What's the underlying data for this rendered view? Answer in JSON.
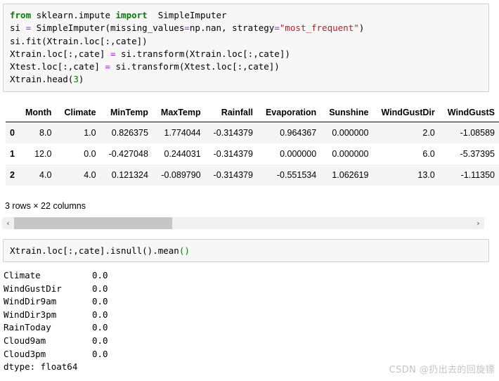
{
  "cell_1": {
    "lines": [
      [
        {
          "t": "from",
          "c": "kw"
        },
        {
          "t": " sklearn.impute ",
          "c": "plain"
        },
        {
          "t": "import",
          "c": "kw"
        },
        {
          "t": "  SimpleImputer",
          "c": "plain"
        }
      ],
      [
        {
          "t": "si ",
          "c": "plain"
        },
        {
          "t": "=",
          "c": "op"
        },
        {
          "t": " SimpleImputer(missing_values",
          "c": "plain"
        },
        {
          "t": "=",
          "c": "op"
        },
        {
          "t": "np.nan, strategy",
          "c": "plain"
        },
        {
          "t": "=",
          "c": "op"
        },
        {
          "t": "\"most_frequent\"",
          "c": "str"
        },
        {
          "t": ")",
          "c": "plain"
        }
      ],
      [
        {
          "t": "si.fit(Xtrain.loc[:,cate])",
          "c": "plain"
        }
      ],
      [
        {
          "t": "Xtrain.loc[:,cate] ",
          "c": "plain"
        },
        {
          "t": "=",
          "c": "op"
        },
        {
          "t": " si.transform(Xtrain.loc[:,cate])",
          "c": "plain"
        }
      ],
      [
        {
          "t": "Xtest.loc[:,cate] ",
          "c": "plain"
        },
        {
          "t": "=",
          "c": "op"
        },
        {
          "t": " si.transform(Xtest.loc[:,cate])",
          "c": "plain"
        }
      ],
      [
        {
          "t": "Xtrain.head(",
          "c": "plain"
        },
        {
          "t": "3",
          "c": "num"
        },
        {
          "t": ")",
          "c": "plain"
        }
      ]
    ]
  },
  "cell_2": {
    "lines": [
      [
        {
          "t": "Xtrain.loc[:,cate].isnull().mean",
          "c": "plain"
        },
        {
          "t": "()",
          "c": "num"
        }
      ]
    ]
  },
  "dataframe": {
    "index_header": "",
    "columns": [
      "Month",
      "Climate",
      "MinTemp",
      "MaxTemp",
      "Rainfall",
      "Evaporation",
      "Sunshine",
      "WindGustDir",
      "WindGustS"
    ],
    "rows": [
      {
        "index": "0",
        "values": [
          "8.0",
          "1.0",
          "0.826375",
          "1.774044",
          "-0.314379",
          "0.964367",
          "0.000000",
          "2.0",
          "-1.08589"
        ]
      },
      {
        "index": "1",
        "values": [
          "12.0",
          "0.0",
          "-0.427048",
          "0.244031",
          "-0.314379",
          "0.000000",
          "0.000000",
          "6.0",
          "-5.37395"
        ]
      },
      {
        "index": "2",
        "values": [
          "4.0",
          "4.0",
          "0.121324",
          "-0.089790",
          "-0.314379",
          "-0.551534",
          "1.062619",
          "13.0",
          "-1.11350"
        ]
      }
    ],
    "shape_caption": "3 rows × 22 columns",
    "scrollbar": {
      "left_arrow": "‹",
      "right_arrow": "›"
    }
  },
  "series_output": {
    "rows": [
      {
        "name": "Climate",
        "value": "0.0"
      },
      {
        "name": "WindGustDir",
        "value": "0.0"
      },
      {
        "name": "WindDir9am",
        "value": "0.0"
      },
      {
        "name": "WindDir3pm",
        "value": "0.0"
      },
      {
        "name": "RainToday",
        "value": "0.0"
      },
      {
        "name": "Cloud9am",
        "value": "0.0"
      },
      {
        "name": "Cloud3pm",
        "value": "0.0"
      }
    ],
    "dtype_line": "dtype: float64"
  },
  "watermark": {
    "text": "CSDN @扔出去的回旋镖"
  },
  "colors": {
    "keyword": "#008000",
    "operator": "#aa22ff",
    "string": "#ba2121",
    "number": "#008000",
    "cell_bg": "#f7f7f7",
    "cell_border": "#cfcfcf",
    "row_stripe": "#f5f5f5",
    "scroll_thumb": "#c6c6c6",
    "watermark": "#c4c4c4"
  }
}
